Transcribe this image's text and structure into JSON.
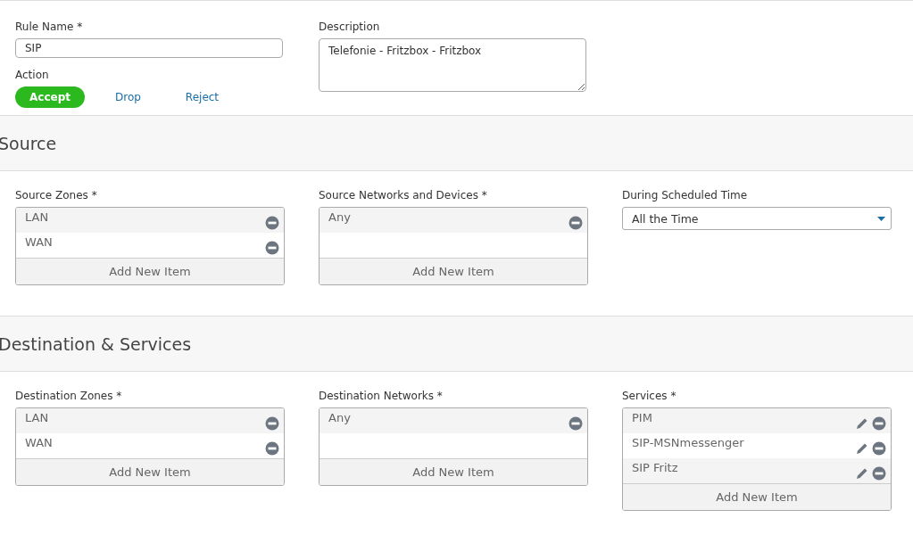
{
  "rule_name": {
    "label": "Rule Name *",
    "value": "SIP"
  },
  "description": {
    "label": "Description",
    "value": "Telefonie - Fritzbox - Fritzbox"
  },
  "action": {
    "label": "Action",
    "options": [
      {
        "label": "Accept",
        "selected": true
      },
      {
        "label": "Drop",
        "selected": false
      },
      {
        "label": "Reject",
        "selected": false
      }
    ]
  },
  "sections": [
    {
      "title": "Source",
      "fields": [
        {
          "kind": "list",
          "label": "Source Zones *",
          "items": [
            {
              "label": "LAN",
              "editable": false
            },
            {
              "label": "WAN",
              "editable": false
            }
          ],
          "add_label": "Add New Item"
        },
        {
          "kind": "list",
          "label": "Source Networks and Devices *",
          "items": [
            {
              "label": "Any",
              "editable": false
            }
          ],
          "add_label": "Add New Item"
        },
        {
          "kind": "select",
          "label": "During Scheduled Time",
          "value": "All the Time"
        }
      ]
    },
    {
      "title": "Destination & Services",
      "fields": [
        {
          "kind": "list",
          "label": "Destination Zones *",
          "items": [
            {
              "label": "LAN",
              "editable": false
            },
            {
              "label": "WAN",
              "editable": false
            }
          ],
          "add_label": "Add New Item"
        },
        {
          "kind": "list",
          "label": "Destination Networks *",
          "items": [
            {
              "label": "Any",
              "editable": false
            }
          ],
          "add_label": "Add New Item"
        },
        {
          "kind": "list",
          "label": "Services *",
          "items": [
            {
              "label": "PIM",
              "editable": true
            },
            {
              "label": "SIP-MSNmessenger",
              "editable": true
            },
            {
              "label": "SIP Fritz",
              "editable": true
            }
          ],
          "add_label": "Add New Item"
        }
      ]
    }
  ]
}
